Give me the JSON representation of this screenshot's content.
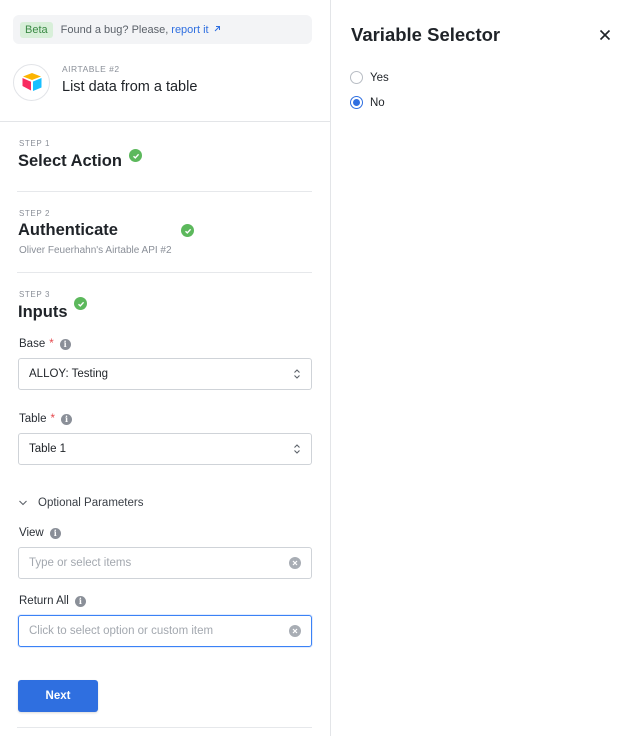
{
  "header": {
    "beta_badge": "Beta",
    "bug_text": "Found a bug? Please,",
    "report_link": "report it",
    "report_icon": "external-link-icon",
    "app_label": "AIRTABLE #2",
    "app_title": "List data from a table",
    "app_icon": "airtable-logo"
  },
  "steps": [
    {
      "label": "STEP 1",
      "title": "Select Action",
      "status": "complete"
    },
    {
      "label": "STEP 2",
      "title": "Authenticate",
      "subtitle": "Oliver Feuerhahn's Airtable API #2",
      "status": "complete"
    },
    {
      "label": "STEP 3",
      "title": "Inputs",
      "status": "complete"
    }
  ],
  "inputs": {
    "base": {
      "label": "Base",
      "required_mark": "*",
      "value": "ALLOY: Testing"
    },
    "table": {
      "label": "Table",
      "required_mark": "*",
      "value": "Table 1"
    },
    "optional_params_label": "Optional Parameters",
    "view": {
      "label": "View",
      "placeholder": "Type or select items"
    },
    "return_all": {
      "label": "Return All",
      "placeholder": "Click to select option or custom item"
    }
  },
  "next_button": "Next",
  "panel": {
    "title": "Variable Selector",
    "options": [
      {
        "label": "Yes",
        "selected": false
      },
      {
        "label": "No",
        "selected": true
      }
    ]
  },
  "colors": {
    "accent": "#2f6fe0",
    "success": "#5cb85c",
    "required": "#e5484d"
  }
}
